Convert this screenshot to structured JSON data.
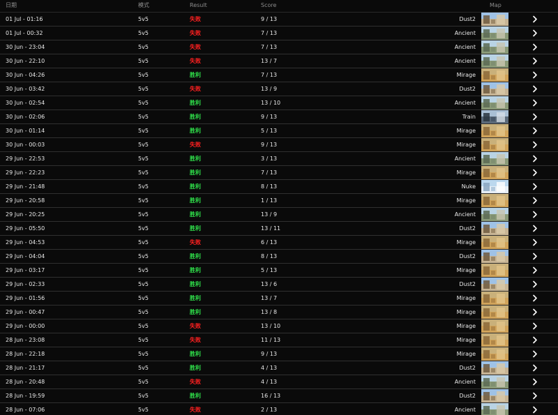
{
  "header": {
    "date": "日期",
    "mode": "模式",
    "result": "Result",
    "score": "Score",
    "map": "Map"
  },
  "colors": {
    "win": "#2fe04a",
    "loss": "#ff2020",
    "background": "#0a0a0a"
  },
  "icons": {
    "row_action": "chevron-right-icon",
    "map": "map-thumbnail"
  },
  "map_palette": {
    "Dust2": [
      "#9fc2e6",
      "#c7b494",
      "#6e5a40",
      "#d9c9a8",
      "#8a7556"
    ],
    "Ancient": [
      "#b9d3e4",
      "#8a9a78",
      "#5a6a54",
      "#c8c6b0",
      "#7a8a6e"
    ],
    "Mirage": [
      "#c9b07a",
      "#d0a35a",
      "#8c6a3a",
      "#e2c48a",
      "#a57a40"
    ],
    "Train": [
      "#a9bfd4",
      "#5b6a7a",
      "#2a3540",
      "#d4dde6",
      "#3e4e60"
    ],
    "Nuke": [
      "#bcd8ee",
      "#e6eef6",
      "#8aa6c0",
      "#ffffff",
      "#9bb8d2"
    ]
  },
  "matches": [
    {
      "date": "01 Jul - 01:16",
      "mode": "5v5",
      "result": "失败",
      "outcome": "loss",
      "score": "9 / 13",
      "map": "Dust2"
    },
    {
      "date": "01 Jul - 00:32",
      "mode": "5v5",
      "result": "失败",
      "outcome": "loss",
      "score": "7 / 13",
      "map": "Ancient"
    },
    {
      "date": "30 Jun - 23:04",
      "mode": "5v5",
      "result": "失败",
      "outcome": "loss",
      "score": "7 / 13",
      "map": "Ancient"
    },
    {
      "date": "30 Jun - 22:10",
      "mode": "5v5",
      "result": "失败",
      "outcome": "loss",
      "score": "13 / 7",
      "map": "Ancient"
    },
    {
      "date": "30 Jun - 04:26",
      "mode": "5v5",
      "result": "胜利",
      "outcome": "win",
      "score": "7 / 13",
      "map": "Mirage"
    },
    {
      "date": "30 Jun - 03:42",
      "mode": "5v5",
      "result": "失败",
      "outcome": "loss",
      "score": "13 / 9",
      "map": "Dust2"
    },
    {
      "date": "30 Jun - 02:54",
      "mode": "5v5",
      "result": "胜利",
      "outcome": "win",
      "score": "13 / 10",
      "map": "Ancient"
    },
    {
      "date": "30 Jun - 02:06",
      "mode": "5v5",
      "result": "胜利",
      "outcome": "win",
      "score": "9 / 13",
      "map": "Train"
    },
    {
      "date": "30 Jun - 01:14",
      "mode": "5v5",
      "result": "胜利",
      "outcome": "win",
      "score": "5 / 13",
      "map": "Mirage"
    },
    {
      "date": "30 Jun - 00:03",
      "mode": "5v5",
      "result": "失败",
      "outcome": "loss",
      "score": "9 / 13",
      "map": "Mirage"
    },
    {
      "date": "29 Jun - 22:53",
      "mode": "5v5",
      "result": "胜利",
      "outcome": "win",
      "score": "3 / 13",
      "map": "Ancient"
    },
    {
      "date": "29 Jun - 22:23",
      "mode": "5v5",
      "result": "胜利",
      "outcome": "win",
      "score": "7 / 13",
      "map": "Mirage"
    },
    {
      "date": "29 Jun - 21:48",
      "mode": "5v5",
      "result": "胜利",
      "outcome": "win",
      "score": "8 / 13",
      "map": "Nuke"
    },
    {
      "date": "29 Jun - 20:58",
      "mode": "5v5",
      "result": "胜利",
      "outcome": "win",
      "score": "1 / 13",
      "map": "Mirage"
    },
    {
      "date": "29 Jun - 20:25",
      "mode": "5v5",
      "result": "胜利",
      "outcome": "win",
      "score": "13 / 9",
      "map": "Ancient"
    },
    {
      "date": "29 Jun - 05:50",
      "mode": "5v5",
      "result": "胜利",
      "outcome": "win",
      "score": "13 / 11",
      "map": "Dust2"
    },
    {
      "date": "29 Jun - 04:53",
      "mode": "5v5",
      "result": "失败",
      "outcome": "loss",
      "score": "6 / 13",
      "map": "Mirage"
    },
    {
      "date": "29 Jun - 04:04",
      "mode": "5v5",
      "result": "胜利",
      "outcome": "win",
      "score": "8 / 13",
      "map": "Dust2"
    },
    {
      "date": "29 Jun - 03:17",
      "mode": "5v5",
      "result": "胜利",
      "outcome": "win",
      "score": "5 / 13",
      "map": "Mirage"
    },
    {
      "date": "29 Jun - 02:33",
      "mode": "5v5",
      "result": "胜利",
      "outcome": "win",
      "score": "13 / 6",
      "map": "Dust2"
    },
    {
      "date": "29 Jun - 01:56",
      "mode": "5v5",
      "result": "胜利",
      "outcome": "win",
      "score": "13 / 7",
      "map": "Mirage"
    },
    {
      "date": "29 Jun - 00:47",
      "mode": "5v5",
      "result": "胜利",
      "outcome": "win",
      "score": "13 / 8",
      "map": "Mirage"
    },
    {
      "date": "29 Jun - 00:00",
      "mode": "5v5",
      "result": "失败",
      "outcome": "loss",
      "score": "13 / 10",
      "map": "Mirage"
    },
    {
      "date": "28 Jun - 23:08",
      "mode": "5v5",
      "result": "失败",
      "outcome": "loss",
      "score": "11 / 13",
      "map": "Mirage"
    },
    {
      "date": "28 Jun - 22:18",
      "mode": "5v5",
      "result": "胜利",
      "outcome": "win",
      "score": "9 / 13",
      "map": "Mirage"
    },
    {
      "date": "28 Jun - 21:17",
      "mode": "5v5",
      "result": "胜利",
      "outcome": "win",
      "score": "4 / 13",
      "map": "Dust2"
    },
    {
      "date": "28 Jun - 20:48",
      "mode": "5v5",
      "result": "失败",
      "outcome": "loss",
      "score": "4 / 13",
      "map": "Ancient"
    },
    {
      "date": "28 Jun - 19:59",
      "mode": "5v5",
      "result": "胜利",
      "outcome": "win",
      "score": "16 / 13",
      "map": "Dust2"
    },
    {
      "date": "28 Jun - 07:06",
      "mode": "5v5",
      "result": "失败",
      "outcome": "loss",
      "score": "2 / 13",
      "map": "Ancient"
    }
  ]
}
